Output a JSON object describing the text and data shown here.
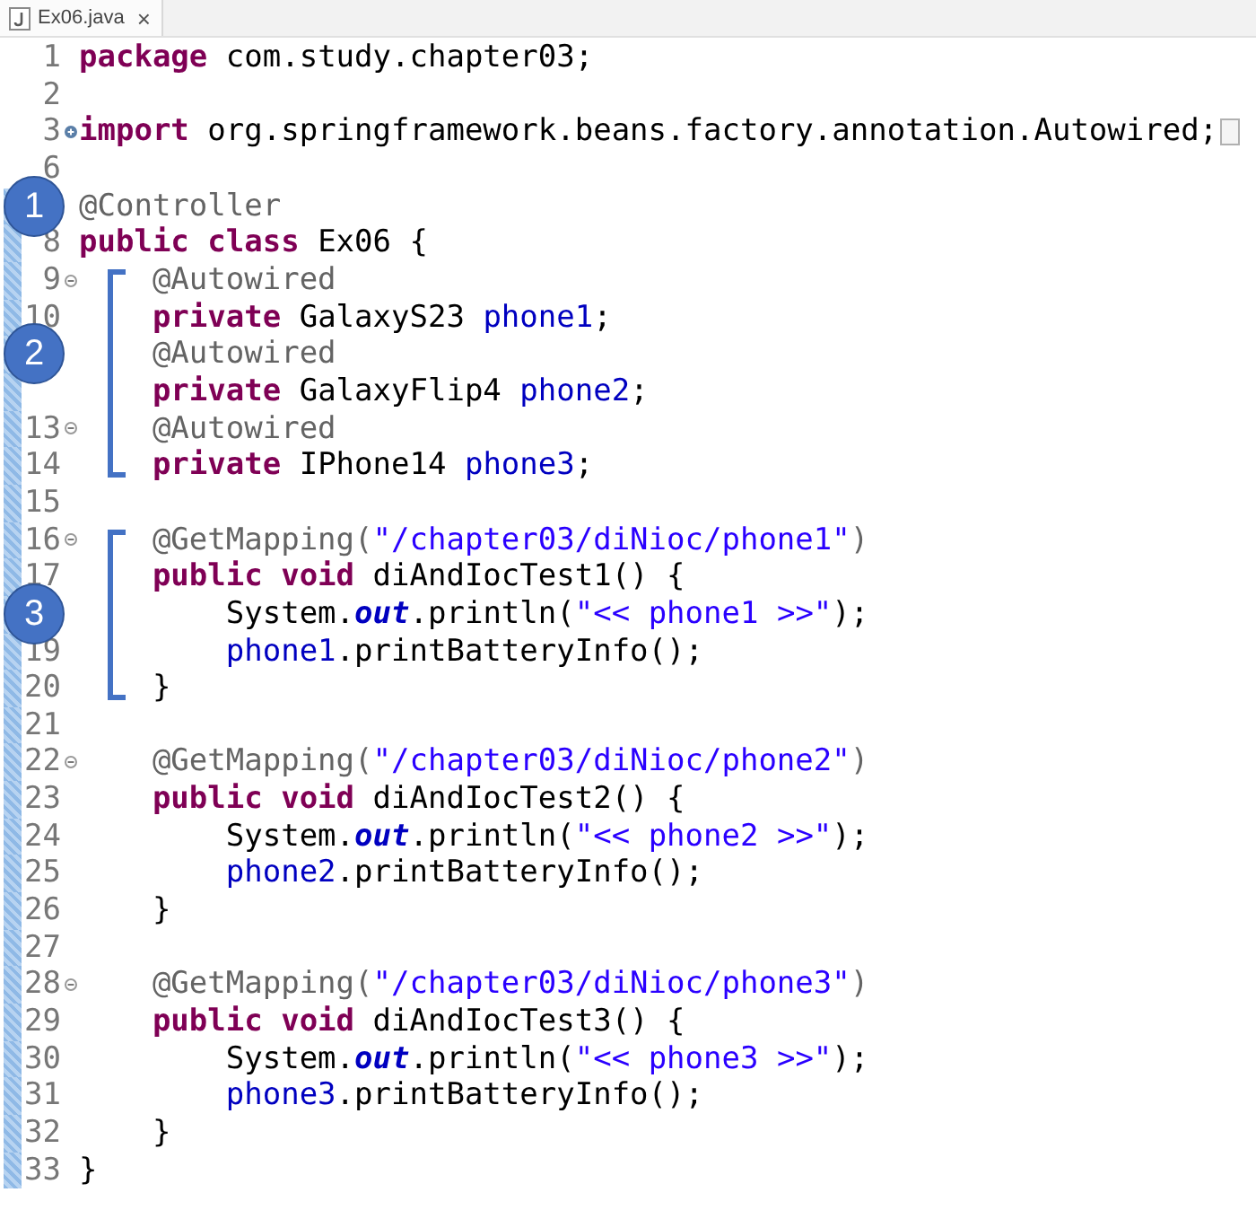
{
  "tab": {
    "title": "Ex06.java",
    "close": "×"
  },
  "lines": [
    {
      "number": "1",
      "code": [
        {
          "kind": "kw",
          "text": "package"
        },
        {
          "kind": "plain",
          "text": " com.study.chapter03;"
        }
      ]
    },
    {
      "number": "2"
    },
    {
      "number": "3",
      "collapsed": true,
      "folded_box": true,
      "code": [
        {
          "kind": "kw",
          "text": "import"
        },
        {
          "kind": "plain",
          "text": " org.springframework.beans.factory.annotation.Autowired;"
        }
      ]
    },
    {
      "number": "6"
    },
    {
      "marker": "1",
      "changed": true,
      "code": [
        {
          "kind": "ann",
          "text": "@Controller"
        }
      ]
    },
    {
      "number": "8",
      "changed": true,
      "code": [
        {
          "kind": "kw",
          "text": "public class"
        },
        {
          "kind": "plain",
          "text": " Ex06 {"
        }
      ]
    },
    {
      "number": "9",
      "collapsed": false,
      "changed": true,
      "bracketed": true,
      "bracket_top": true,
      "code": [
        {
          "kind": "ann",
          "text": "    @Autowired"
        }
      ]
    },
    {
      "number": "10",
      "changed": true,
      "bracketed": true,
      "code": [
        {
          "kind": "kw",
          "text": "    private"
        },
        {
          "kind": "plain",
          "text": " GalaxyS23 "
        },
        {
          "kind": "field",
          "text": "phone1"
        },
        {
          "kind": "plain",
          "text": ";"
        }
      ]
    },
    {
      "marker": "2",
      "changed": true,
      "bracketed": true,
      "code": [
        {
          "kind": "ann",
          "text": "    @Autowired"
        }
      ]
    },
    {
      "changed": true,
      "bracketed": true,
      "code": [
        {
          "kind": "kw",
          "text": "    private"
        },
        {
          "kind": "plain",
          "text": " GalaxyFlip4 "
        },
        {
          "kind": "field",
          "text": "phone2"
        },
        {
          "kind": "plain",
          "text": ";"
        }
      ]
    },
    {
      "number": "13",
      "collapsed": false,
      "changed": true,
      "bracketed": true,
      "code": [
        {
          "kind": "ann",
          "text": "    @Autowired"
        }
      ]
    },
    {
      "number": "14",
      "changed": true,
      "bracketed": true,
      "bracket_bottom": true,
      "code": [
        {
          "kind": "kw",
          "text": "    private"
        },
        {
          "kind": "plain",
          "text": " IPhone14 "
        },
        {
          "kind": "field",
          "text": "phone3"
        },
        {
          "kind": "plain",
          "text": ";"
        }
      ]
    },
    {
      "number": "15",
      "changed": true
    },
    {
      "number": "16",
      "collapsed": false,
      "changed": true,
      "bracketed": true,
      "bracket_top": true,
      "code": [
        {
          "kind": "ann",
          "text": "    @GetMapping("
        },
        {
          "kind": "str",
          "text": "\"/chapter03/diNioc/phone1\""
        },
        {
          "kind": "ann",
          "text": ")"
        }
      ]
    },
    {
      "number": "17",
      "changed": true,
      "bracketed": true,
      "code": [
        {
          "kind": "kw",
          "text": "    public void"
        },
        {
          "kind": "plain",
          "text": " diAndIocTest1() {"
        }
      ]
    },
    {
      "marker": "3",
      "changed": true,
      "bracketed": true,
      "code": [
        {
          "kind": "plain",
          "text": "        System."
        },
        {
          "kind": "static",
          "text": "out"
        },
        {
          "kind": "plain",
          "text": ".println("
        },
        {
          "kind": "str",
          "text": "\"<< phone1 >>\""
        },
        {
          "kind": "plain",
          "text": ");"
        }
      ]
    },
    {
      "number": "19",
      "changed": true,
      "bracketed": true,
      "code": [
        {
          "kind": "field",
          "text": "        phone1"
        },
        {
          "kind": "plain",
          "text": ".printBatteryInfo();"
        }
      ]
    },
    {
      "number": "20",
      "changed": true,
      "bracketed": true,
      "bracket_bottom": true,
      "code": [
        {
          "kind": "plain",
          "text": "    }"
        }
      ]
    },
    {
      "number": "21",
      "changed": true
    },
    {
      "number": "22",
      "collapsed": false,
      "changed": true,
      "code": [
        {
          "kind": "ann",
          "text": "    @GetMapping("
        },
        {
          "kind": "str",
          "text": "\"/chapter03/diNioc/phone2\""
        },
        {
          "kind": "ann",
          "text": ")"
        }
      ]
    },
    {
      "number": "23",
      "changed": true,
      "code": [
        {
          "kind": "kw",
          "text": "    public void"
        },
        {
          "kind": "plain",
          "text": " diAndIocTest2() {"
        }
      ]
    },
    {
      "number": "24",
      "changed": true,
      "code": [
        {
          "kind": "plain",
          "text": "        System."
        },
        {
          "kind": "static",
          "text": "out"
        },
        {
          "kind": "plain",
          "text": ".println("
        },
        {
          "kind": "str",
          "text": "\"<< phone2 >>\""
        },
        {
          "kind": "plain",
          "text": ");"
        }
      ]
    },
    {
      "number": "25",
      "changed": true,
      "code": [
        {
          "kind": "field",
          "text": "        phone2"
        },
        {
          "kind": "plain",
          "text": ".printBatteryInfo();"
        }
      ]
    },
    {
      "number": "26",
      "changed": true,
      "code": [
        {
          "kind": "plain",
          "text": "    }"
        }
      ]
    },
    {
      "number": "27",
      "changed": true
    },
    {
      "number": "28",
      "collapsed": false,
      "changed": true,
      "code": [
        {
          "kind": "ann",
          "text": "    @GetMapping("
        },
        {
          "kind": "str",
          "text": "\"/chapter03/diNioc/phone3\""
        },
        {
          "kind": "ann",
          "text": ")"
        }
      ]
    },
    {
      "number": "29",
      "changed": true,
      "code": [
        {
          "kind": "kw",
          "text": "    public void"
        },
        {
          "kind": "plain",
          "text": " diAndIocTest3() {"
        }
      ]
    },
    {
      "number": "30",
      "changed": true,
      "code": [
        {
          "kind": "plain",
          "text": "        System."
        },
        {
          "kind": "static",
          "text": "out"
        },
        {
          "kind": "plain",
          "text": ".println("
        },
        {
          "kind": "str",
          "text": "\"<< phone3 >>\""
        },
        {
          "kind": "plain",
          "text": ");"
        }
      ]
    },
    {
      "number": "31",
      "changed": true,
      "code": [
        {
          "kind": "field",
          "text": "        phone3"
        },
        {
          "kind": "plain",
          "text": ".printBatteryInfo();"
        }
      ]
    },
    {
      "number": "32",
      "changed": true,
      "code": [
        {
          "kind": "plain",
          "text": "    }"
        }
      ]
    },
    {
      "number": "33",
      "changed": true,
      "code": [
        {
          "kind": "plain",
          "text": "}"
        }
      ]
    }
  ]
}
